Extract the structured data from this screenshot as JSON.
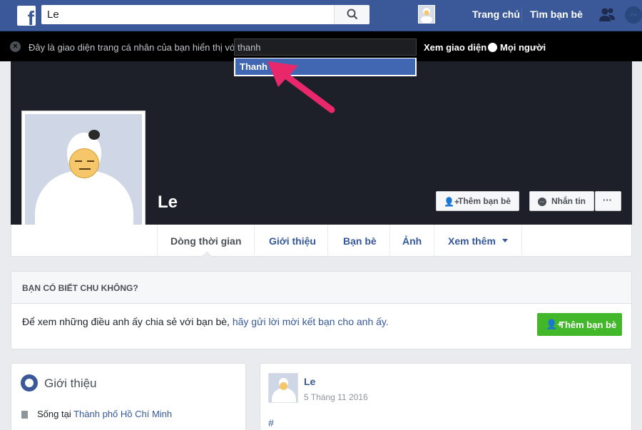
{
  "topbar": {
    "logo": "f",
    "search_value": "Le",
    "nav_home": "Trang chủ",
    "nav_find_friends": "Tìm bạn bè"
  },
  "viewas": {
    "description": "Đây là giao diện trang cá nhân của bạn hiển thị với:",
    "input_value": "thanh",
    "suggestion": "Thanh",
    "view_as": "Xem giao diện",
    "everyone": "Mọi người"
  },
  "profile": {
    "name": "Le",
    "add_friend": "Thêm bạn bè",
    "message": "Nhắn tin",
    "more": "···"
  },
  "tabs": [
    {
      "label": "Dòng thời gian"
    },
    {
      "label": "Giới thiệu"
    },
    {
      "label": "Bạn bè"
    },
    {
      "label": "Ảnh"
    },
    {
      "label": "Xem thêm"
    }
  ],
  "know_card": {
    "title": "BẠN CÓ BIẾT CHU KHÔNG?",
    "text": "Để xem những điều anh ấy chia sẻ với bạn bè, ",
    "link": "hãy gửi lời mời kết bạn cho anh ấy.",
    "button": "Thêm bạn bè"
  },
  "intro": {
    "title": "Giới thiệu",
    "lives_in": "Sống tại",
    "place": "Thành phố Hồ Chí Minh"
  },
  "post": {
    "author": "Le",
    "date": "5 Tháng 11 2016",
    "hashtag": "#"
  },
  "colors": {
    "fb_blue": "#3b5998",
    "link_blue": "#365899",
    "green": "#42b72a",
    "arrow_pink": "#e8286b"
  },
  "icons": {
    "search": "search-icon",
    "friends": "friend-requests-icon",
    "messenger": "messenger-icon",
    "globe": "globe-icon",
    "close": "close-icon",
    "add_friend": "add-friend-icon",
    "intro": "intro-globe-icon",
    "home": "home-location-icon"
  }
}
